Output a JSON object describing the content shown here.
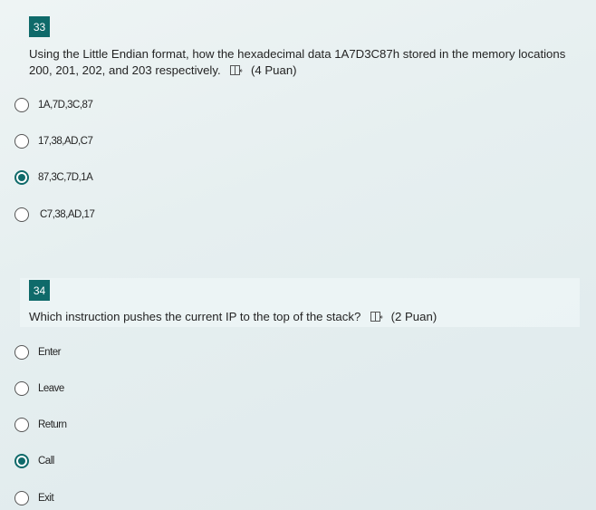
{
  "questions": [
    {
      "number": "33",
      "text": "Using the Little Endian format, how the hexadecimal data 1A7D3C87h stored in the memory locations 200, 201, 202, and 203 respectively.",
      "points": "(4 Puan)",
      "options": [
        {
          "label": "1A,7D,3C,87",
          "selected": false
        },
        {
          "label": "17,38,AD,C7",
          "selected": false
        },
        {
          "label": "87,3C,7D,1A",
          "selected": true
        },
        {
          "label": "C7,38,AD,17",
          "selected": false
        }
      ]
    },
    {
      "number": "34",
      "text": "Which instruction pushes the current IP to the top of the stack?",
      "points": "(2 Puan)",
      "options": [
        {
          "label": "Enter",
          "selected": false
        },
        {
          "label": "Leave",
          "selected": false
        },
        {
          "label": "Return",
          "selected": false
        },
        {
          "label": "Call",
          "selected": true
        },
        {
          "label": "Exit",
          "selected": false
        }
      ]
    }
  ],
  "colors": {
    "accent": "#0f6a6a"
  },
  "icons": {
    "immersive_reader": "immersive-reader-icon"
  }
}
